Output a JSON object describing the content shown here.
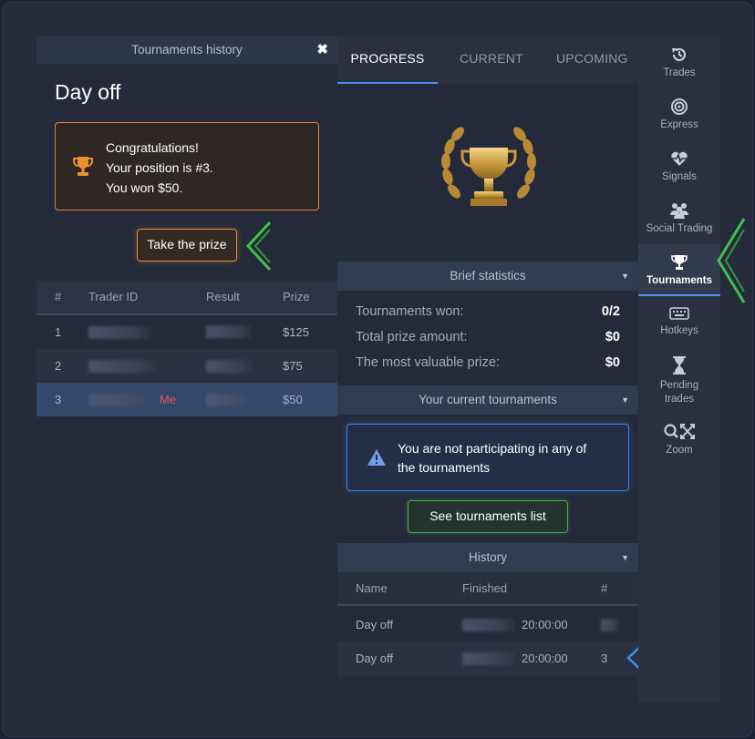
{
  "left_panel": {
    "header_title": "Tournaments history",
    "close_glyph": "✖",
    "title": "Day off",
    "congrats": {
      "line1": "Congratulations!",
      "line2": "Your position is #3.",
      "line3": "You won $50."
    },
    "take_prize_label": "Take the prize",
    "table": {
      "headers": [
        "#",
        "Trader ID",
        "Result",
        "Prize"
      ],
      "rows": [
        {
          "rank": "1",
          "prize": "$125"
        },
        {
          "rank": "2",
          "prize": "$75"
        },
        {
          "rank": "3",
          "me_label": "Me",
          "prize": "$50"
        }
      ]
    }
  },
  "center_panel": {
    "tabs": [
      "PROGRESS",
      "CURRENT",
      "UPCOMING"
    ],
    "active_tab": "PROGRESS",
    "brief_statistics_label": "Brief statistics",
    "stats": [
      {
        "label": "Tournaments won:",
        "value": "0/2"
      },
      {
        "label": "Total prize amount:",
        "value": "$0"
      },
      {
        "label": "The most valuable prize:",
        "value": "$0"
      }
    ],
    "current_tournaments_label": "Your current tournaments",
    "notice_line1": "You are not participating in any of",
    "notice_line2": "the tournaments",
    "see_list_label": "See tournaments list",
    "history_label": "History",
    "history_table": {
      "headers": [
        "Name",
        "Finished",
        "#"
      ],
      "rows": [
        {
          "name": "Day off",
          "time": "20:00:00",
          "rank": ""
        },
        {
          "name": "Day off",
          "time": "20:00:00",
          "rank": "3"
        }
      ]
    }
  },
  "sidebar": {
    "items": [
      {
        "label": "Trades",
        "icon": "history-icon"
      },
      {
        "label": "Express",
        "icon": "target-icon"
      },
      {
        "label": "Signals",
        "icon": "heart-pulse-icon"
      },
      {
        "label": "Social Trading",
        "icon": "users-icon"
      },
      {
        "label": "Tournaments",
        "icon": "trophy-icon",
        "active": true
      },
      {
        "label": "Hotkeys",
        "icon": "keyboard-icon"
      },
      {
        "label": "Pending",
        "label2": "trades",
        "icon": "hourglass-icon"
      },
      {
        "label": "Zoom",
        "icon": "zoom-icon"
      }
    ]
  },
  "colors": {
    "accent_blue": "#4d8ff0",
    "orange": "#e08b3e",
    "green": "#3fb34f",
    "me_red": "#e05a4f"
  }
}
